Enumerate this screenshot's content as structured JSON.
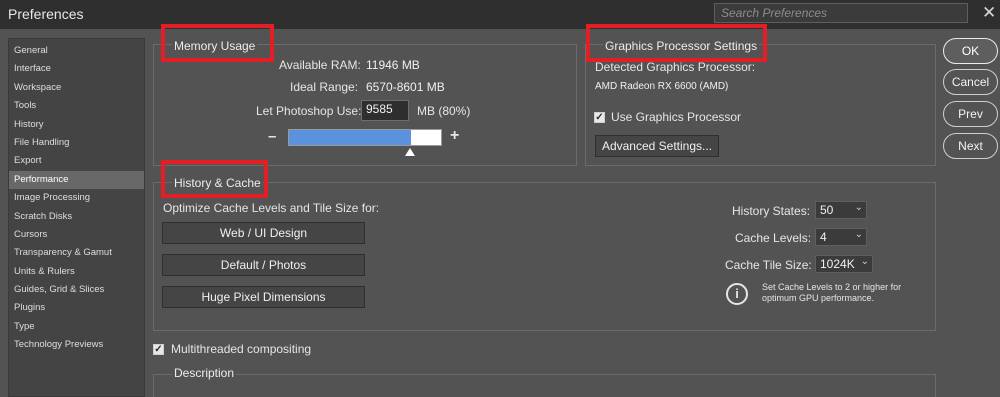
{
  "window": {
    "title": "Preferences",
    "search_placeholder": "Search Preferences",
    "close_glyph": "✕"
  },
  "sidebar": {
    "items": [
      {
        "label": "General",
        "active": false
      },
      {
        "label": "Interface",
        "active": false
      },
      {
        "label": "Workspace",
        "active": false
      },
      {
        "label": "Tools",
        "active": false
      },
      {
        "label": "History",
        "active": false
      },
      {
        "label": "File Handling",
        "active": false
      },
      {
        "label": "Export",
        "active": false
      },
      {
        "label": "Performance",
        "active": true
      },
      {
        "label": "Image Processing",
        "active": false
      },
      {
        "label": "Scratch Disks",
        "active": false
      },
      {
        "label": "Cursors",
        "active": false
      },
      {
        "label": "Transparency & Gamut",
        "active": false
      },
      {
        "label": "Units & Rulers",
        "active": false
      },
      {
        "label": "Guides, Grid & Slices",
        "active": false
      },
      {
        "label": "Plugins",
        "active": false
      },
      {
        "label": "Type",
        "active": false
      },
      {
        "label": "Technology Previews",
        "active": false
      }
    ]
  },
  "memory": {
    "title": "Memory Usage",
    "available_label": "Available RAM:",
    "available_value": "11946 MB",
    "ideal_label": "Ideal Range:",
    "ideal_value": "6570-8601 MB",
    "use_label": "Let Photoshop Use:",
    "use_value": "9585",
    "use_unit": "MB (80%)",
    "minus": "–",
    "plus": "+",
    "slider_fraction": 0.8
  },
  "gpu": {
    "title": "Graphics Processor Settings",
    "detected_label": "Detected Graphics Processor:",
    "detected_value": "AMD Radeon RX 6600 (AMD)",
    "use_gpu_label": "Use Graphics Processor",
    "use_gpu_checked": true,
    "advanced_button": "Advanced Settings..."
  },
  "history_cache": {
    "title": "History & Cache",
    "optimize_label": "Optimize Cache Levels and Tile Size for:",
    "buttons": [
      "Web / UI Design",
      "Default / Photos",
      "Huge Pixel Dimensions"
    ],
    "history_states_label": "History States:",
    "history_states_value": "50",
    "cache_levels_label": "Cache Levels:",
    "cache_levels_value": "4",
    "tile_size_label": "Cache Tile Size:",
    "tile_size_value": "1024K",
    "info_text_1": "Set Cache Levels to 2 or higher for",
    "info_text_2": "optimum GPU performance."
  },
  "multithreaded": {
    "label": "Multithreaded compositing",
    "checked": true
  },
  "description": {
    "title": "Description"
  },
  "actions": {
    "ok": "OK",
    "cancel": "Cancel",
    "prev": "Prev",
    "next": "Next"
  },
  "annotation_color": "#e31e24"
}
